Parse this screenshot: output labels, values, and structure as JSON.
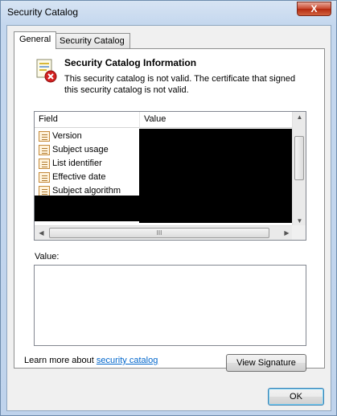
{
  "window": {
    "title": "Security Catalog",
    "close_symbol": "X"
  },
  "tabs": [
    {
      "label": "General",
      "active": true
    },
    {
      "label": "Security Catalog",
      "active": false
    }
  ],
  "info": {
    "title": "Security Catalog Information",
    "message": "This security catalog is not valid. The certificate that signed this security catalog is not valid."
  },
  "fields_list": {
    "columns": [
      "Field",
      "Value"
    ],
    "rows": [
      "Version",
      "Subject usage",
      "List identifier",
      "Effective date",
      "Subject algorithm"
    ],
    "hscroll_grip": "III"
  },
  "value_label": "Value:",
  "footer": {
    "learn_prefix": "Learn more about ",
    "learn_link": "security catalog"
  },
  "buttons": {
    "view_signature": "View Signature",
    "ok": "OK"
  },
  "icons": {
    "certificate": "certificate-error-icon",
    "field": "field-icon"
  },
  "colors": {
    "link": "#0066cc",
    "close_button": "#c7462c",
    "error_badge": "#d42020"
  }
}
